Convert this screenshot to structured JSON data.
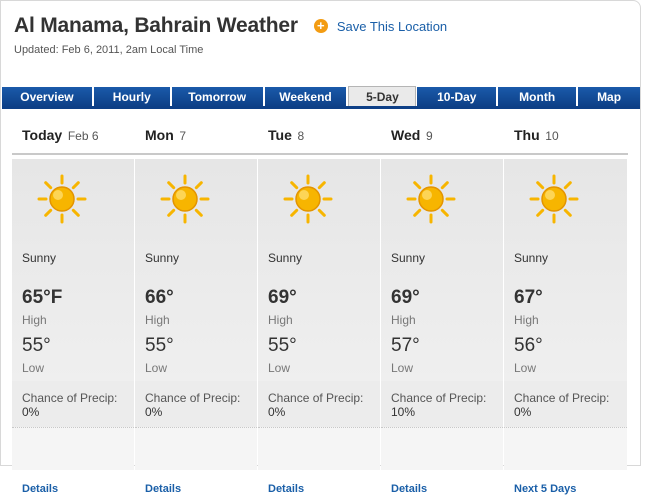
{
  "header": {
    "title": "Al Manama, Bahrain Weather",
    "save_label": "Save This Location",
    "updated": "Updated: Feb 6, 2011, 2am Local Time"
  },
  "tabs": [
    {
      "label": "Overview"
    },
    {
      "label": "Hourly"
    },
    {
      "label": "Tomorrow"
    },
    {
      "label": "Weekend"
    },
    {
      "label": "5-Day",
      "active": true
    },
    {
      "label": "10-Day"
    },
    {
      "label": "Month"
    },
    {
      "label": "Map"
    }
  ],
  "days": [
    {
      "name": "Today",
      "date": "Feb 6",
      "condition": "Sunny",
      "high": "65°F",
      "high_label": "High",
      "low": "55°",
      "low_label": "Low",
      "precip_label": "Chance of Precip:",
      "precip": "0%",
      "link": "Details"
    },
    {
      "name": "Mon",
      "date": "7",
      "condition": "Sunny",
      "high": "66°",
      "high_label": "High",
      "low": "55°",
      "low_label": "Low",
      "precip_label": "Chance of Precip:",
      "precip": "0%",
      "link": "Details"
    },
    {
      "name": "Tue",
      "date": "8",
      "condition": "Sunny",
      "high": "69°",
      "high_label": "High",
      "low": "55°",
      "low_label": "Low",
      "precip_label": "Chance of Precip:",
      "precip": "0%",
      "link": "Details"
    },
    {
      "name": "Wed",
      "date": "9",
      "condition": "Sunny",
      "high": "69°",
      "high_label": "High",
      "low": "57°",
      "low_label": "Low",
      "precip_label": "Chance of Precip:",
      "precip": "10%",
      "link": "Details"
    },
    {
      "name": "Thu",
      "date": "10",
      "condition": "Sunny",
      "high": "67°",
      "high_label": "High",
      "low": "56°",
      "low_label": "Low",
      "precip_label": "Chance of Precip:",
      "precip": "0%",
      "link": "Next 5 Days"
    }
  ],
  "icons": {
    "condition_icon": "sunny-icon",
    "save_icon": "plus-circle-icon"
  },
  "colors": {
    "tab_blue": "#0d3f86",
    "link_blue": "#1a5fa8",
    "save_icon": "#f39c12",
    "sun": "#f7b500"
  }
}
